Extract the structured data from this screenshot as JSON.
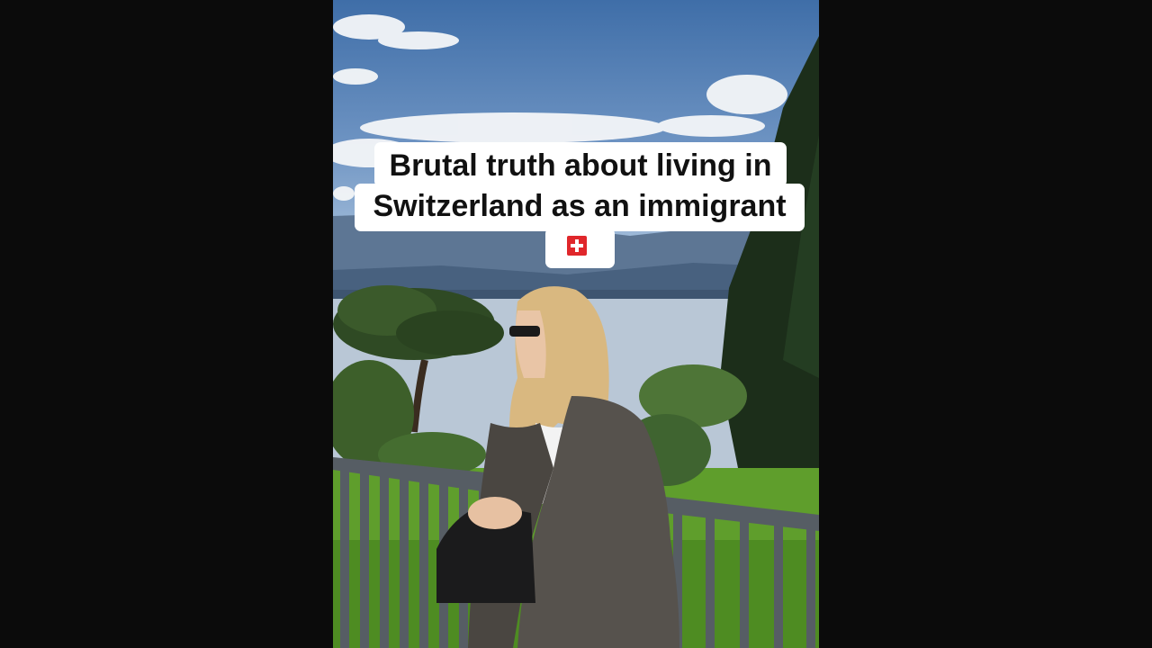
{
  "caption": {
    "line1": "Brutal truth about living in",
    "line2": "Switzerland as an immigrant",
    "emoji": "swiss-flag-icon"
  },
  "colors": {
    "letterbox": "#0b0b0b",
    "caption_bg": "#ffffff",
    "caption_text": "#111111",
    "flag_red": "#e0272b"
  }
}
